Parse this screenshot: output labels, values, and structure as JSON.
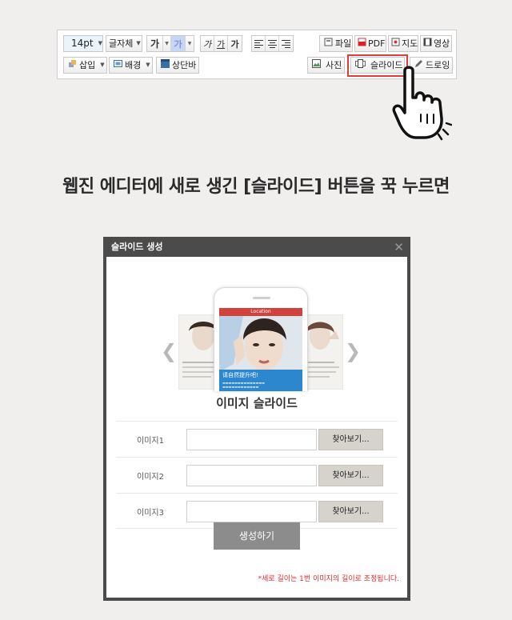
{
  "toolbar": {
    "font_size": "14pt",
    "font_family": "글자체",
    "bold_sample": "가",
    "color_sample": "가",
    "style_buttons": [
      "가",
      "가",
      "가"
    ],
    "file": "파일",
    "pdf": "PDF",
    "map": "지도",
    "video": "영상",
    "insert": "삽입",
    "background": "배경",
    "topbar": "상단바",
    "photo": "사진",
    "slide": "슬라이드",
    "drawing": "드로잉"
  },
  "headline": "웹진 에디터에 새로 생긴 [슬라이드] 버튼을 꾹 누르면",
  "dialog": {
    "title": "슬라이드 생성",
    "close": "✕",
    "preview": {
      "location_label": "Location",
      "caption": "请自然提升吧!",
      "left_arrow": "❮",
      "right_arrow": "❯"
    },
    "section_title": "이미지 슬라이드",
    "rows": [
      {
        "label": "이미지1",
        "value": "",
        "button": "찾아보기..."
      },
      {
        "label": "이미지2",
        "value": "",
        "button": "찾아보기..."
      },
      {
        "label": "이미지3",
        "value": "",
        "button": "찾아보기..."
      }
    ],
    "create_button": "생성하기",
    "note": "*세로 길이는 1번 이미지의 길이로 조정됩니다."
  },
  "colors": {
    "highlight_border": "#e23b3b",
    "dialog_frame": "#4b4b4b",
    "note_red": "#e8282b",
    "caption_blue": "#2382cd"
  }
}
